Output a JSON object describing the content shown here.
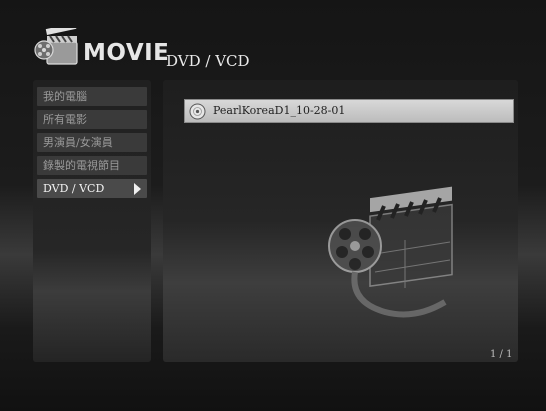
{
  "app": {
    "title": "MOVIE"
  },
  "section": {
    "title": "DVD / VCD"
  },
  "sidebar": {
    "items": [
      {
        "label": "我的電腦"
      },
      {
        "label": "所有電影"
      },
      {
        "label": "男演員/女演員"
      },
      {
        "label": "錄製的電視節目"
      },
      {
        "label": "DVD / VCD",
        "selected": true
      }
    ]
  },
  "files": [
    {
      "name": "PearlKoreaD1_10-28-01",
      "icon": "disc-icon"
    }
  ],
  "pagination": {
    "text": "1 / 1"
  },
  "colors": {
    "background": "#151515",
    "selected_row": "#cccccc",
    "text": "#e8e8e8"
  }
}
